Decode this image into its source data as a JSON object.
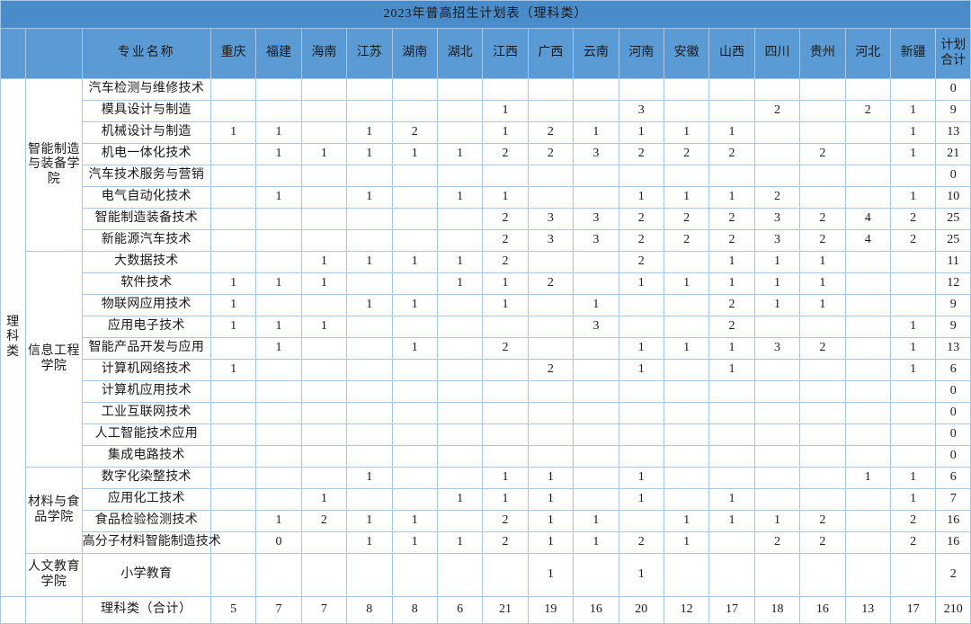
{
  "title": "2023年普高招生计划表（理科类）",
  "header": {
    "blank1": "",
    "blank2": "",
    "major_label": "专业名称",
    "provinces": [
      "重庆",
      "福建",
      "海南",
      "江苏",
      "湖南",
      "湖北",
      "江西",
      "广西",
      "云南",
      "河南",
      "安徽",
      "山西",
      "四川",
      "贵州",
      "河北",
      "新疆"
    ],
    "total_label": "计划\n合计",
    "total_label_line1": "计划",
    "total_label_line2": "合计"
  },
  "category": "理科类",
  "departments": [
    {
      "name": "智能制造与装备学院",
      "rowspan": 8
    },
    {
      "name": "信息工程学院",
      "rowspan": 10
    },
    {
      "name": "材料与食品学院",
      "rowspan": 4
    },
    {
      "name": "人文教育学院",
      "rowspan": 1
    }
  ],
  "chart_data": {
    "type": "table",
    "title": "2023年普高招生计划表（理科类）",
    "categories": [
      "重庆",
      "福建",
      "海南",
      "江苏",
      "湖南",
      "湖北",
      "江西",
      "广西",
      "云南",
      "河南",
      "安徽",
      "山西",
      "四川",
      "贵州",
      "河北",
      "新疆"
    ],
    "rows": [
      {
        "department": "智能制造与装备学院",
        "major": "汽车检测与维修技术",
        "values": [
          "",
          "",
          "",
          "",
          "",
          "",
          "",
          "",
          "",
          "",
          "",
          "",
          "",
          "",
          "",
          ""
        ],
        "total": "0"
      },
      {
        "department": "智能制造与装备学院",
        "major": "模具设计与制造",
        "values": [
          "",
          "",
          "",
          "",
          "",
          "",
          "1",
          "",
          "",
          "3",
          "",
          "",
          "2",
          "",
          "2",
          "1"
        ],
        "total": "9"
      },
      {
        "department": "智能制造与装备学院",
        "major": "机械设计与制造",
        "values": [
          "1",
          "1",
          "",
          "1",
          "2",
          "",
          "1",
          "2",
          "1",
          "1",
          "1",
          "1",
          "",
          "",
          "",
          "1"
        ],
        "total": "13"
      },
      {
        "department": "智能制造与装备学院",
        "major": "机电一体化技术",
        "values": [
          "",
          "1",
          "1",
          "1",
          "1",
          "1",
          "2",
          "2",
          "3",
          "2",
          "2",
          "2",
          "",
          "2",
          "",
          "1"
        ],
        "total": "21"
      },
      {
        "department": "智能制造与装备学院",
        "major": "汽车技术服务与营销",
        "values": [
          "",
          "",
          "",
          "",
          "",
          "",
          "",
          "",
          "",
          "",
          "",
          "",
          "",
          "",
          "",
          ""
        ],
        "total": "0"
      },
      {
        "department": "智能制造与装备学院",
        "major": "电气自动化技术",
        "values": [
          "",
          "1",
          "",
          "1",
          "",
          "1",
          "1",
          "",
          "",
          "1",
          "1",
          "1",
          "2",
          "",
          "",
          "1"
        ],
        "total": "10"
      },
      {
        "department": "智能制造与装备学院",
        "major": "智能制造装备技术",
        "values": [
          "",
          "",
          "",
          "",
          "",
          "",
          "2",
          "3",
          "3",
          "2",
          "2",
          "2",
          "3",
          "2",
          "4",
          "2"
        ],
        "total": "25"
      },
      {
        "department": "智能制造与装备学院",
        "major": "新能源汽车技术",
        "values": [
          "",
          "",
          "",
          "",
          "",
          "",
          "2",
          "3",
          "3",
          "2",
          "2",
          "2",
          "3",
          "2",
          "4",
          "2"
        ],
        "total": "25"
      },
      {
        "department": "信息工程学院",
        "major": "大数据技术",
        "values": [
          "",
          "",
          "1",
          "1",
          "1",
          "1",
          "2",
          "",
          "",
          "2",
          "",
          "1",
          "1",
          "1",
          "",
          ""
        ],
        "total": "11"
      },
      {
        "department": "信息工程学院",
        "major": "软件技术",
        "values": [
          "1",
          "1",
          "1",
          "",
          "",
          "1",
          "1",
          "2",
          "",
          "1",
          "1",
          "1",
          "1",
          "1",
          "",
          ""
        ],
        "total": "12"
      },
      {
        "department": "信息工程学院",
        "major": "物联网应用技术",
        "values": [
          "1",
          "",
          "",
          "1",
          "1",
          "",
          "1",
          "",
          "1",
          "",
          "",
          "2",
          "1",
          "1",
          "",
          ""
        ],
        "total": "9"
      },
      {
        "department": "信息工程学院",
        "major": "应用电子技术",
        "values": [
          "1",
          "1",
          "1",
          "",
          "",
          "",
          "",
          "",
          "3",
          "",
          "",
          "2",
          "",
          "",
          "",
          "1"
        ],
        "total": "9"
      },
      {
        "department": "信息工程学院",
        "major": "智能产品开发与应用",
        "values": [
          "",
          "1",
          "",
          "",
          "1",
          "",
          "2",
          "",
          "",
          "1",
          "1",
          "1",
          "3",
          "2",
          "",
          "1"
        ],
        "total": "13"
      },
      {
        "department": "信息工程学院",
        "major": "计算机网络技术",
        "values": [
          "1",
          "",
          "",
          "",
          "",
          "",
          "",
          "2",
          "",
          "1",
          "",
          "1",
          "",
          "",
          "",
          "1"
        ],
        "total": "6"
      },
      {
        "department": "信息工程学院",
        "major": "计算机应用技术",
        "values": [
          "",
          "",
          "",
          "",
          "",
          "",
          "",
          "",
          "",
          "",
          "",
          "",
          "",
          "",
          "",
          ""
        ],
        "total": "0"
      },
      {
        "department": "信息工程学院",
        "major": "工业互联网技术",
        "values": [
          "",
          "",
          "",
          "",
          "",
          "",
          "",
          "",
          "",
          "",
          "",
          "",
          "",
          "",
          "",
          ""
        ],
        "total": "0"
      },
      {
        "department": "信息工程学院",
        "major": "人工智能技术应用",
        "values": [
          "",
          "",
          "",
          "",
          "",
          "",
          "",
          "",
          "",
          "",
          "",
          "",
          "",
          "",
          "",
          ""
        ],
        "total": "0"
      },
      {
        "department": "信息工程学院",
        "major": "集成电路技术",
        "values": [
          "",
          "",
          "",
          "",
          "",
          "",
          "",
          "",
          "",
          "",
          "",
          "",
          "",
          "",
          "",
          ""
        ],
        "total": "0"
      },
      {
        "department": "材料与食品学院",
        "major": "数字化染整技术",
        "values": [
          "",
          "",
          "",
          "1",
          "",
          "",
          "1",
          "1",
          "",
          "1",
          "",
          "",
          "",
          "",
          "1",
          "1"
        ],
        "total": "6"
      },
      {
        "department": "材料与食品学院",
        "major": "应用化工技术",
        "values": [
          "",
          "",
          "1",
          "",
          "",
          "1",
          "1",
          "1",
          "",
          "1",
          "",
          "1",
          "",
          "",
          "",
          "1"
        ],
        "total": "7"
      },
      {
        "department": "材料与食品学院",
        "major": "食品检验检测技术",
        "values": [
          "",
          "1",
          "2",
          "1",
          "1",
          "",
          "2",
          "1",
          "1",
          "",
          "1",
          "1",
          "1",
          "2",
          "",
          "2"
        ],
        "total": "16"
      },
      {
        "department": "材料与食品学院",
        "major": "高分子材料智能制造技术",
        "values": [
          "",
          "0",
          "",
          "1",
          "1",
          "1",
          "2",
          "1",
          "1",
          "2",
          "1",
          "",
          "2",
          "2",
          "",
          "2"
        ],
        "total": "16"
      },
      {
        "department": "人文教育学院",
        "major": "小学教育",
        "values": [
          "",
          "",
          "",
          "",
          "",
          "",
          "",
          "1",
          "",
          "1",
          "",
          "",
          "",
          "",
          "",
          ""
        ],
        "total": "2"
      }
    ],
    "total_row": {
      "label": "理科类（合计）",
      "values": [
        "5",
        "7",
        "7",
        "8",
        "8",
        "6",
        "21",
        "19",
        "16",
        "20",
        "12",
        "17",
        "18",
        "16",
        "13",
        "17"
      ],
      "total": "210"
    }
  },
  "colors": {
    "title_bg": "#4a8bc9",
    "header_bg": "#5b9bd5",
    "border": "#a8c6e6",
    "text": "#1a1a1a"
  }
}
